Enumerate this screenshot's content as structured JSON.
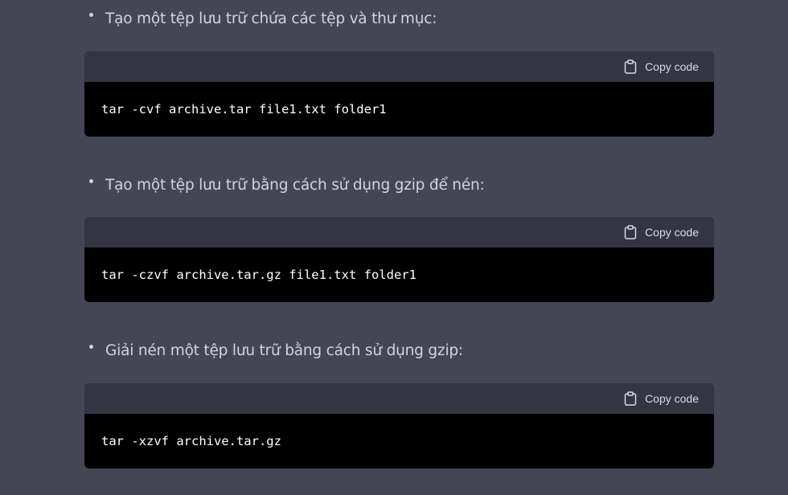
{
  "items": [
    {
      "text": "Tạo một tệp lưu trữ chứa các tệp và thư mục:",
      "copy_label": "Copy code",
      "code": "tar -cvf archive.tar file1.txt folder1"
    },
    {
      "text": "Tạo một tệp lưu trữ bằng cách sử dụng gzip để nén:",
      "copy_label": "Copy code",
      "code": "tar -czvf archive.tar.gz file1.txt folder1"
    },
    {
      "text": "Giải nén một tệp lưu trữ bằng cách sử dụng gzip:",
      "copy_label": "Copy code",
      "code": "tar -xzvf archive.tar.gz"
    }
  ],
  "icons": {
    "copy": "clipboard-icon"
  },
  "colors": {
    "page_background": "#444654",
    "code_header_background": "#343541",
    "code_body_background": "#000000",
    "text": "#d1d5db",
    "code_text": "#ffffff"
  }
}
